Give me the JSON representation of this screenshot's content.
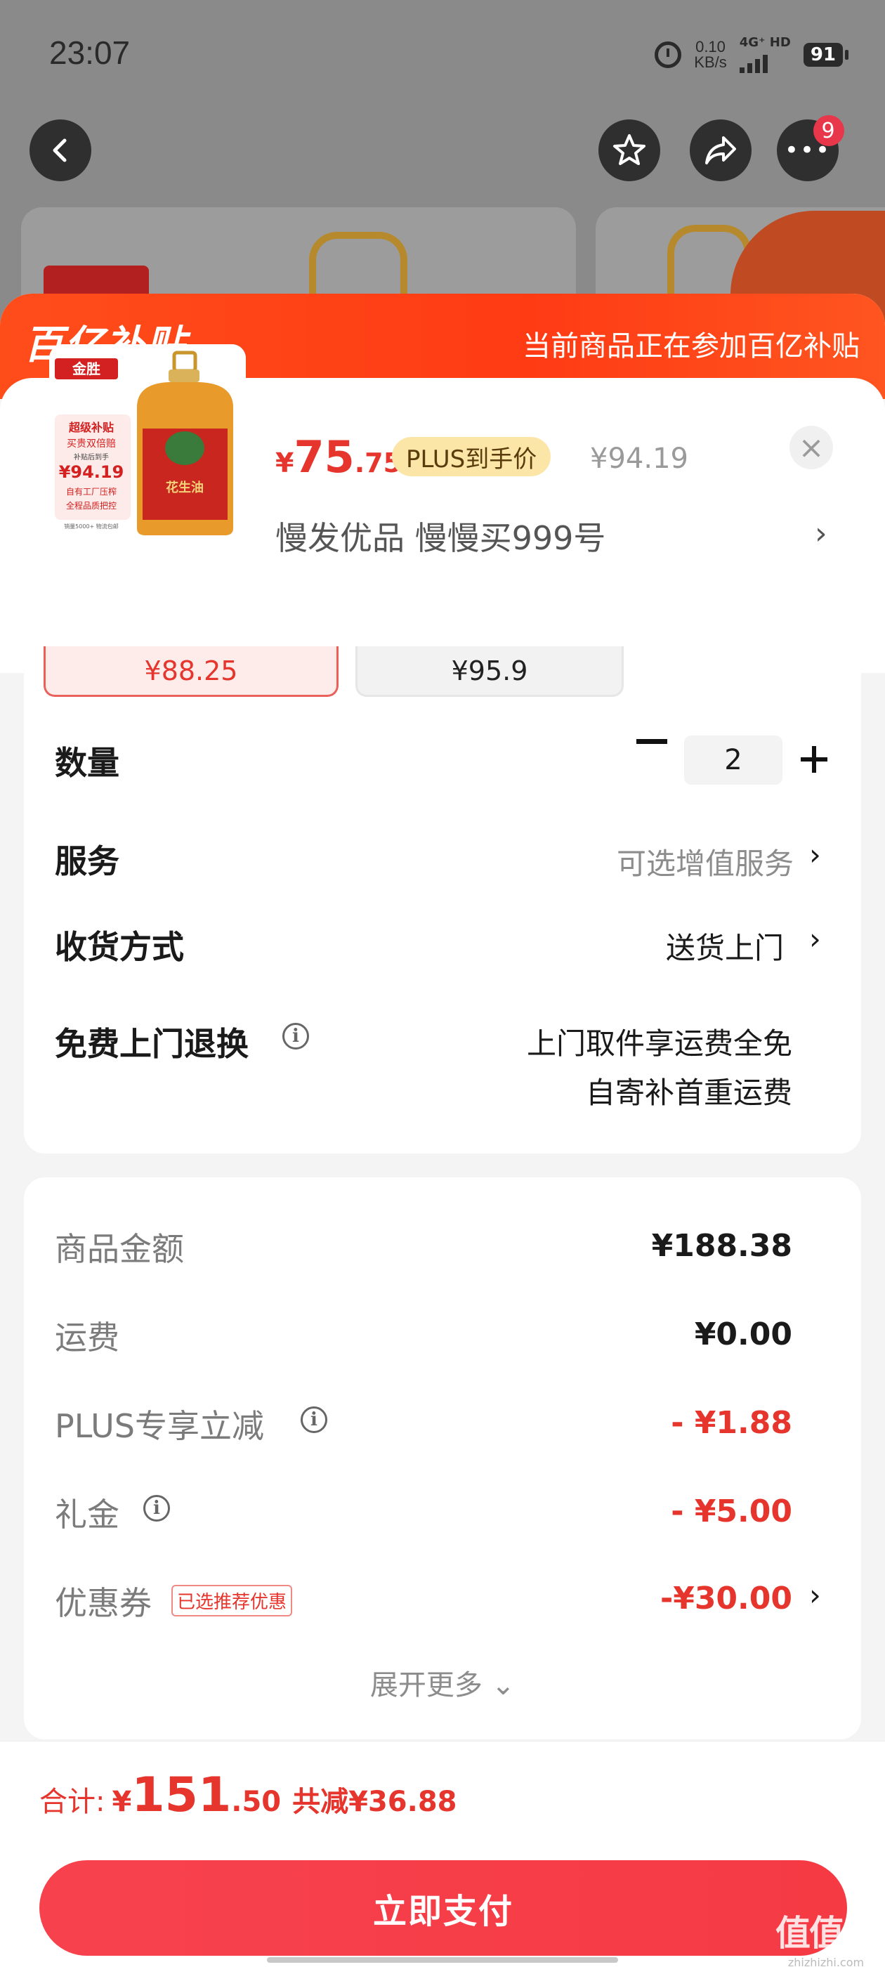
{
  "status_bar": {
    "time": "23:07",
    "net_speed": "0.10",
    "net_speed_unit": "KB/s",
    "net_type": "4G⁺ HD",
    "battery": "91"
  },
  "nav": {
    "back_icon": "chevron-left-icon",
    "favorite_icon": "star-icon",
    "share_icon": "share-icon",
    "more_icon": "more-icon",
    "more_badge": "9"
  },
  "promo": {
    "logo_text": "百亿补贴",
    "banner_text": "当前商品正在参加百亿补贴"
  },
  "product": {
    "thumb_brand": "金胜",
    "thumb_promo_1": "超级补贴",
    "thumb_promo_2": "买贵双倍赔",
    "thumb_price_label": "补贴后到手",
    "thumb_price": "¥94.19",
    "thumb_tag_1": "自有工厂压榨",
    "thumb_tag_2": "全程品质把控",
    "thumb_footnote": "销量5000+ 物流包邮",
    "price_currency": "¥",
    "price_int": "75",
    "price_dec": ".75",
    "plus_tag": "PLUS到手价",
    "original_price": "¥94.19",
    "store": "慢发优品  慢慢买999号",
    "close_icon": "close-icon"
  },
  "spec_options": [
    {
      "label": "¥88.25",
      "selected": true
    },
    {
      "label": "¥95.9",
      "selected": false
    }
  ],
  "rows": {
    "quantity_label": "数量",
    "quantity_value": "2",
    "service_label": "服务",
    "service_value": "可选增值服务",
    "delivery_label": "收货方式",
    "delivery_value": "送货上门",
    "return_label": "免费上门退换",
    "return_value_1": "上门取件享运费全免",
    "return_value_2": "自寄补首重运费"
  },
  "pricing": {
    "goods_label": "商品金额",
    "goods_value": "¥188.38",
    "shipping_label": "运费",
    "shipping_value": "¥0.00",
    "plus_label": "PLUS专享立减",
    "plus_value": "- ¥1.88",
    "gift_label": "礼金",
    "gift_value": "- ¥5.00",
    "coupon_label": "优惠券",
    "coupon_tag": "已选推荐优惠",
    "coupon_value": "-¥30.00",
    "expand_label": "展开更多"
  },
  "total": {
    "label": "合计:",
    "currency": "¥",
    "int": "151",
    "dec": ".50",
    "saving": "共减¥36.88"
  },
  "pay_button": "立即支付",
  "watermark": {
    "big": "值值值",
    "small": "zhizhizhi.com"
  },
  "colors": {
    "accent_red": "#e5352c",
    "promo_orange": "#ff4d1a",
    "plus_gold": "#fbe6a8",
    "pay_button": "#f7424e"
  }
}
